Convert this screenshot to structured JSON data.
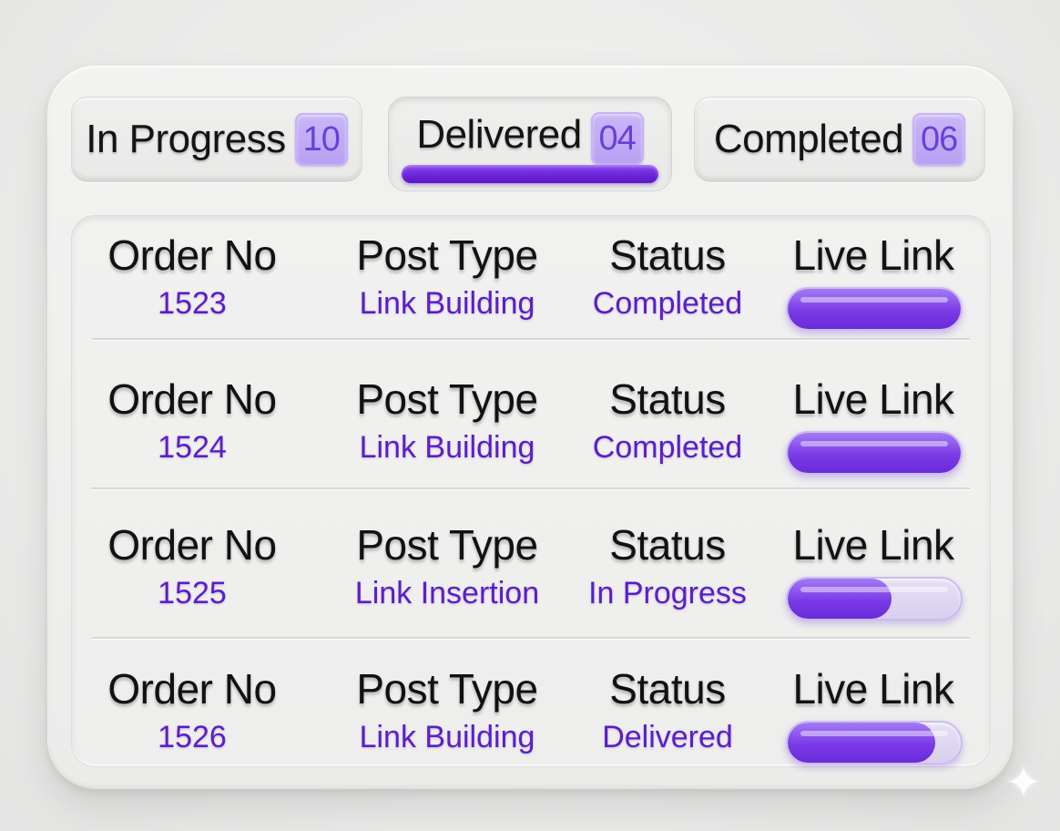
{
  "tabs": [
    {
      "label": "In Progress",
      "count": "10",
      "active": false
    },
    {
      "label": "Delivered",
      "count": "04",
      "active": true
    },
    {
      "label": "Completed",
      "count": "06",
      "active": false
    }
  ],
  "table": {
    "columns": [
      "Order No",
      "Post Type",
      "Status",
      "Live Link"
    ],
    "rows": [
      {
        "order_no": "1523",
        "post_type": "Link Building",
        "status": "Completed",
        "live_link_fill": 1.0
      },
      {
        "order_no": "1524",
        "post_type": "Link Building",
        "status": "Completed",
        "live_link_fill": 1.0
      },
      {
        "order_no": "1525",
        "post_type": "Link Insertion",
        "status": "In Progress",
        "live_link_fill": 0.6
      },
      {
        "order_no": "1526",
        "post_type": "Link Building",
        "status": "Delivered",
        "live_link_fill": 0.85
      }
    ]
  },
  "colors": {
    "accent": "#6a22d6",
    "value_text": "#5a1fc7",
    "badge_bg": "#c4aff6"
  },
  "icons": {
    "corner": "sparkle-icon"
  }
}
